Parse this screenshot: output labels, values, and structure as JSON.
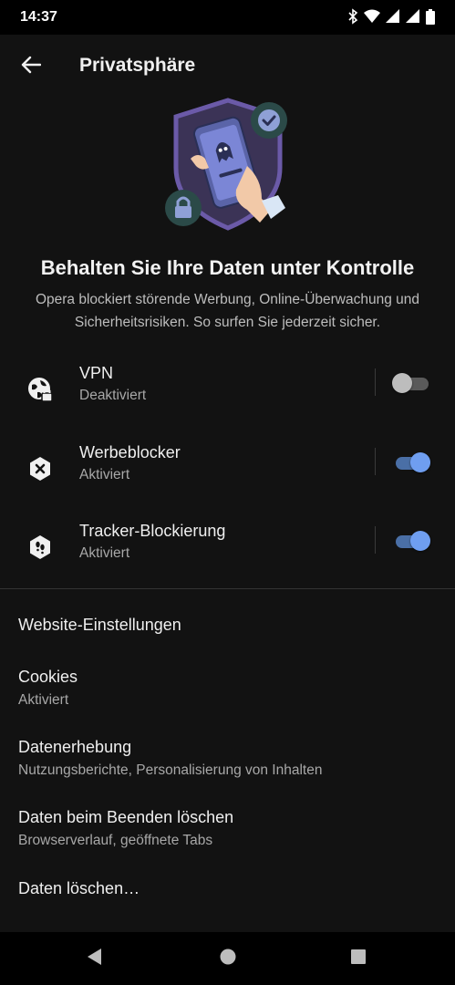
{
  "status_bar": {
    "time": "14:37",
    "icons": [
      "bluetooth-icon",
      "wifi-icon",
      "signal-icon",
      "signal-icon",
      "battery-icon"
    ]
  },
  "app_bar": {
    "back_icon": "arrow-back-icon",
    "title": "Privatsphäre"
  },
  "hero": {
    "headline": "Behalten Sie Ihre Daten unter Kontrolle",
    "description": "Opera blockiert störende Werbung, Online-Überwachung und Sicherheitsrisiken. So surfen Sie jederzeit sicher."
  },
  "toggles": [
    {
      "icon": "globe-lock-icon",
      "title": "VPN",
      "status": "Deaktiviert",
      "enabled": false
    },
    {
      "icon": "ad-block-icon",
      "title": "Werbeblocker",
      "status": "Aktiviert",
      "enabled": true
    },
    {
      "icon": "tracker-block-icon",
      "title": "Tracker-Blockierung",
      "status": "Aktiviert",
      "enabled": true
    }
  ],
  "settings": [
    {
      "title": "Website-Einstellungen",
      "subtitle": ""
    },
    {
      "title": "Cookies",
      "subtitle": "Aktiviert"
    },
    {
      "title": "Datenerhebung",
      "subtitle": "Nutzungsberichte, Personalisierung von Inhalten"
    },
    {
      "title": "Daten beim Beenden löschen",
      "subtitle": "Browserverlauf, geöffnete Tabs"
    },
    {
      "title": "Daten löschen…",
      "subtitle": ""
    }
  ],
  "nav_bar": {
    "buttons": [
      "back-triangle-icon",
      "home-circle-icon",
      "recents-square-icon"
    ]
  },
  "colors": {
    "background": "#121212",
    "accent": "#6f9ef0",
    "shield": "#6b5aa8",
    "badge": "#2b4a48"
  }
}
